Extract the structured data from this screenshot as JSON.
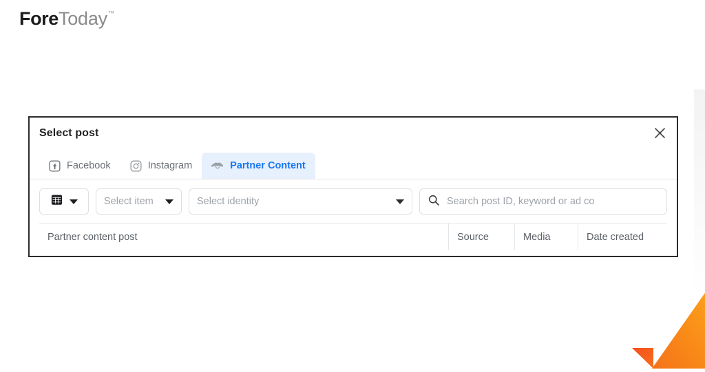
{
  "brand": {
    "name_bold": "Fore",
    "name_light": "Today",
    "trademark": "™"
  },
  "dialog": {
    "title": "Select post",
    "close_label": "×",
    "close_icon": "close-icon",
    "tabs": [
      {
        "id": "facebook",
        "label": "Facebook",
        "icon": "facebook-icon",
        "active": false
      },
      {
        "id": "instagram",
        "label": "Instagram",
        "icon": "instagram-icon",
        "active": false
      },
      {
        "id": "partner-content",
        "label": "Partner Content",
        "icon": "handshake-icon",
        "active": true
      }
    ],
    "filters": {
      "view_selector": {
        "icon": "grid-icon",
        "caret_icon": "chevron-down-icon"
      },
      "item_select": {
        "label": "Select item",
        "caret_icon": "chevron-down-icon"
      },
      "identity_select": {
        "label": "Select identity",
        "caret_icon": "chevron-down-icon"
      },
      "search": {
        "placeholder": "Search post ID, keyword or ad co",
        "value": "",
        "icon": "search-icon"
      }
    },
    "table": {
      "columns": [
        {
          "id": "post",
          "label": "Partner content post"
        },
        {
          "id": "source",
          "label": "Source"
        },
        {
          "id": "media",
          "label": "Media"
        },
        {
          "id": "date",
          "label": "Date created"
        }
      ],
      "rows": []
    }
  },
  "decoration": {
    "corner_graphic": "orange-ribbon-graphic",
    "colors": {
      "accent_blue": "#1877f2",
      "tab_active_bg": "#e7f0fd",
      "orange_light": "#fb9a1b",
      "orange_mid": "#f7861a",
      "orange_dark": "#f4511e",
      "dialog_border": "#2b2b2b",
      "muted_text": "#9ea3a9"
    }
  }
}
